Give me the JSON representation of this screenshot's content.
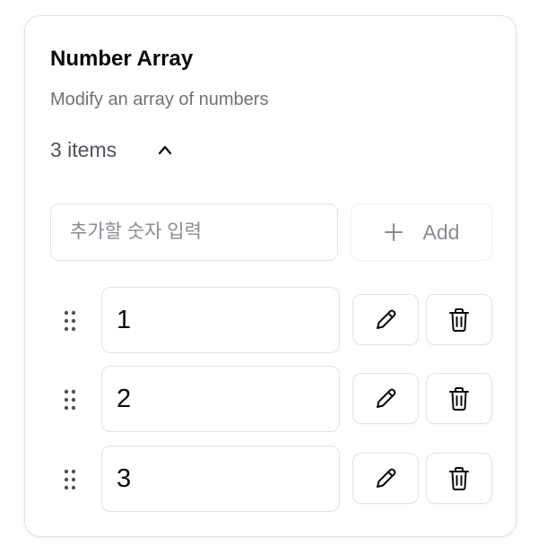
{
  "card": {
    "title": "Number Array",
    "description": "Modify an array of numbers",
    "count_label": "3 items",
    "expanded": true
  },
  "new_item": {
    "placeholder": "추가할 숫자 입력",
    "value": "",
    "add_label": "Add"
  },
  "items": [
    {
      "value": "1"
    },
    {
      "value": "2"
    },
    {
      "value": "3"
    }
  ],
  "icons": {
    "collapse": "chevron-up-icon",
    "add": "plus-icon",
    "drag": "grip-vertical-icon",
    "edit": "pencil-icon",
    "delete": "trash-icon"
  }
}
